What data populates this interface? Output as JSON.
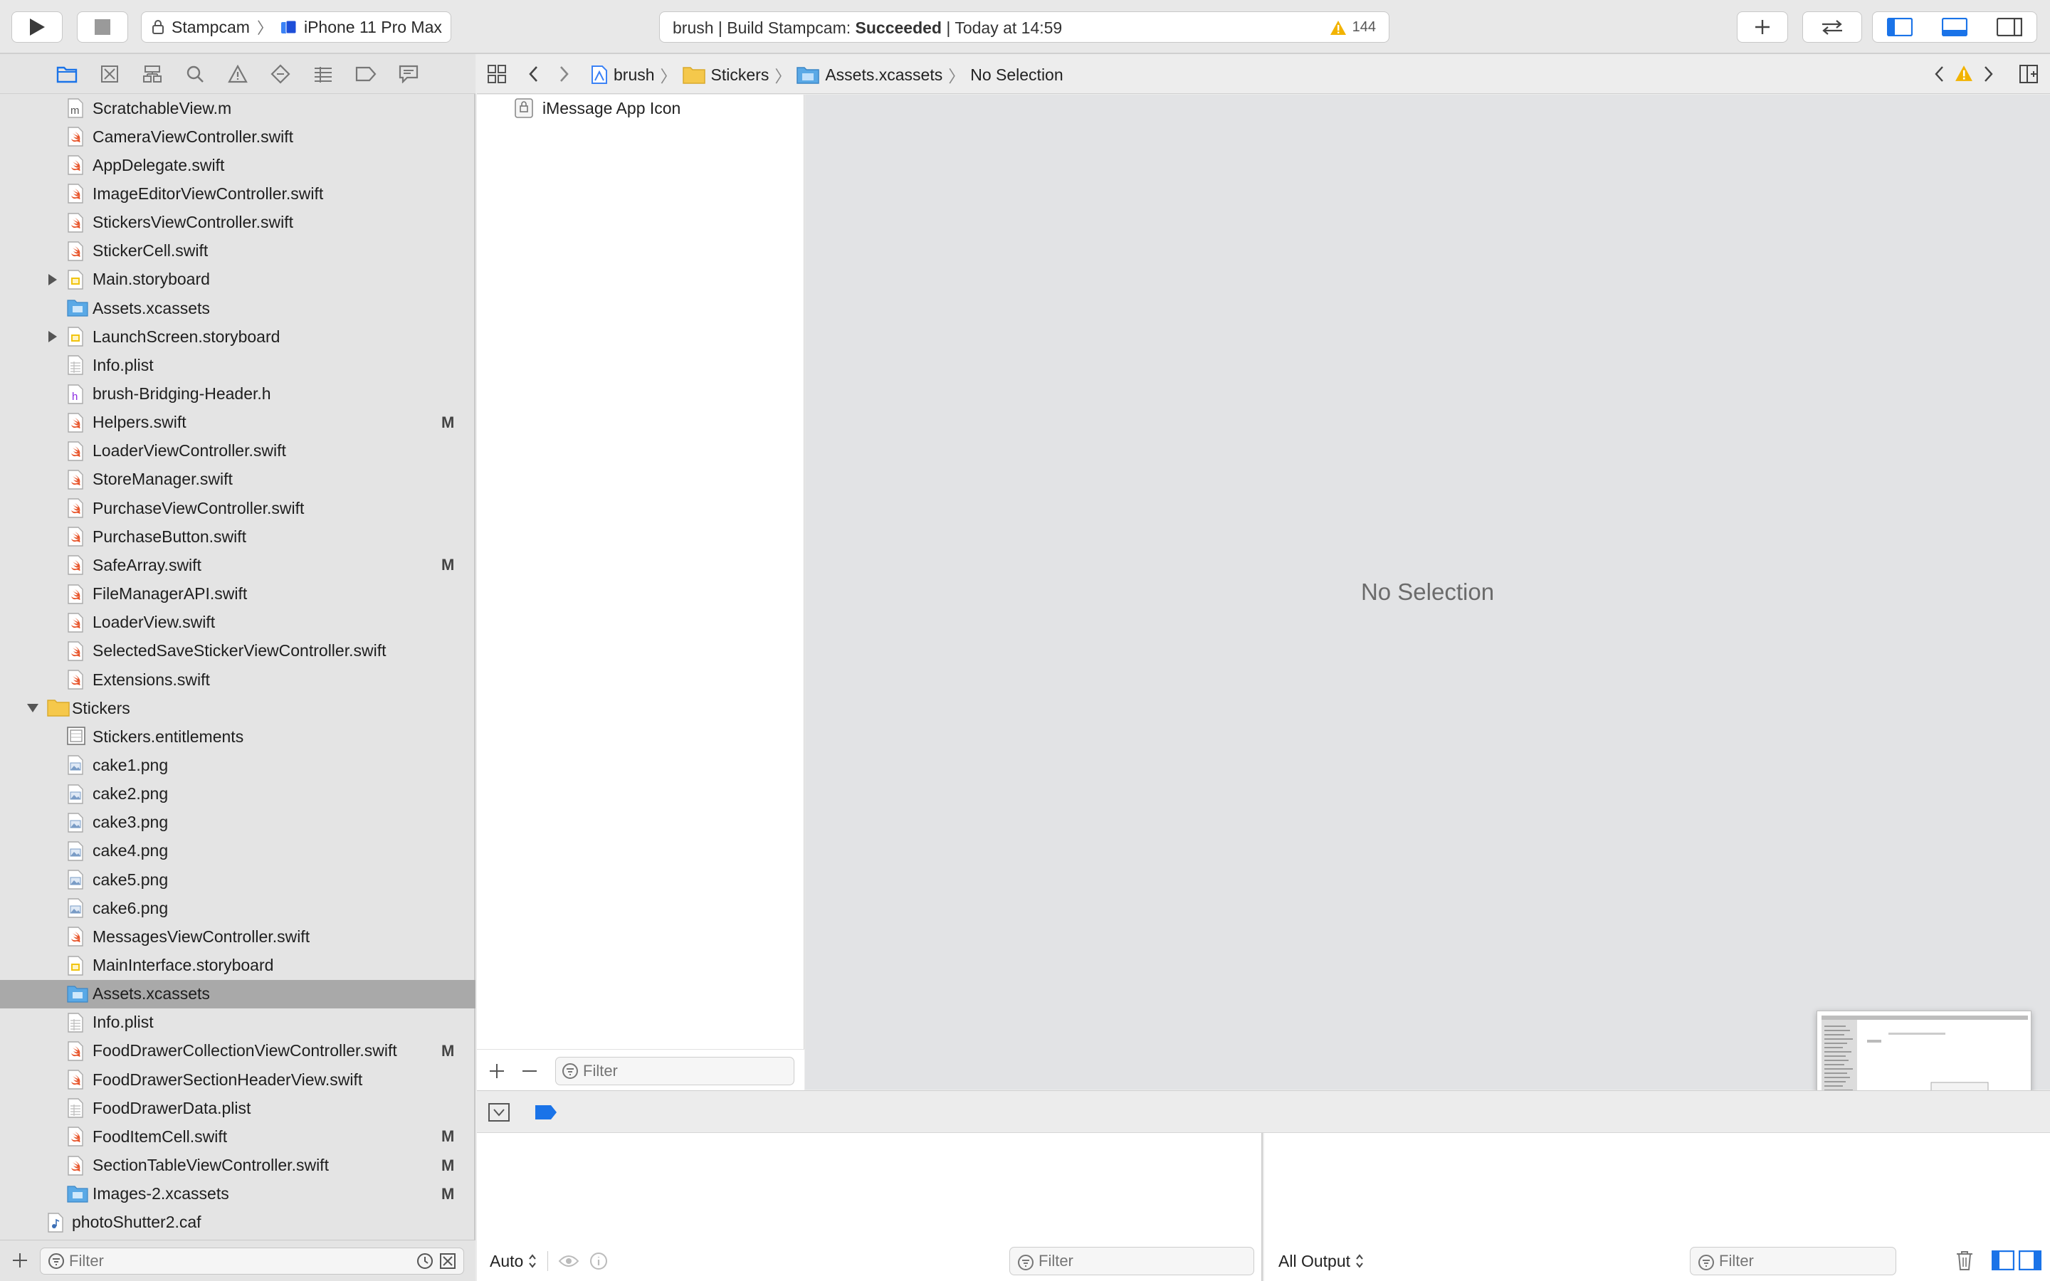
{
  "toolbar": {
    "scheme_target": "Stampcam",
    "scheme_device": "iPhone 11 Pro Max",
    "status_prefix": "brush | Build Stampcam: ",
    "status_result": "Succeeded",
    "status_suffix": " | Today at 14:59",
    "warning_count": "144"
  },
  "navigator": {
    "items": [
      {
        "label": "ScratchableView.m",
        "icon": "m"
      },
      {
        "label": "CameraViewController.swift",
        "icon": "swift"
      },
      {
        "label": "AppDelegate.swift",
        "icon": "swift"
      },
      {
        "label": "ImageEditorViewController.swift",
        "icon": "swift"
      },
      {
        "label": "StickersViewController.swift",
        "icon": "swift"
      },
      {
        "label": "StickerCell.swift",
        "icon": "swift"
      },
      {
        "label": "Main.storyboard",
        "icon": "storyboard"
      },
      {
        "label": "Assets.xcassets",
        "icon": "assets"
      },
      {
        "label": "LaunchScreen.storyboard",
        "icon": "storyboard"
      },
      {
        "label": "Info.plist",
        "icon": "plist"
      },
      {
        "label": "brush-Bridging-Header.h",
        "icon": "h"
      },
      {
        "label": "Helpers.swift",
        "icon": "swift",
        "badge": "M"
      },
      {
        "label": "LoaderViewController.swift",
        "icon": "swift"
      },
      {
        "label": "StoreManager.swift",
        "icon": "swift"
      },
      {
        "label": "PurchaseViewController.swift",
        "icon": "swift"
      },
      {
        "label": "PurchaseButton.swift",
        "icon": "swift"
      },
      {
        "label": "SafeArray.swift",
        "icon": "swift",
        "badge": "M"
      },
      {
        "label": "FileManagerAPI.swift",
        "icon": "swift"
      },
      {
        "label": "LoaderView.swift",
        "icon": "swift"
      },
      {
        "label": "SelectedSaveStickerViewController.swift",
        "icon": "swift"
      },
      {
        "label": "Extensions.swift",
        "icon": "swift"
      },
      {
        "label": "Stickers",
        "icon": "folder"
      },
      {
        "label": "Stickers.entitlements",
        "icon": "entitlements"
      },
      {
        "label": "cake1.png",
        "icon": "image"
      },
      {
        "label": "cake2.png",
        "icon": "image"
      },
      {
        "label": "cake3.png",
        "icon": "image"
      },
      {
        "label": "cake4.png",
        "icon": "image"
      },
      {
        "label": "cake5.png",
        "icon": "image"
      },
      {
        "label": "cake6.png",
        "icon": "image"
      },
      {
        "label": "MessagesViewController.swift",
        "icon": "swift"
      },
      {
        "label": "MainInterface.storyboard",
        "icon": "storyboard"
      },
      {
        "label": "Assets.xcassets",
        "icon": "assets"
      },
      {
        "label": "Info.plist",
        "icon": "plist"
      },
      {
        "label": "FoodDrawerCollectionViewController.swift",
        "icon": "swift",
        "badge": "M"
      },
      {
        "label": "FoodDrawerSectionHeaderView.swift",
        "icon": "swift"
      },
      {
        "label": "FoodDrawerData.plist",
        "icon": "plist"
      },
      {
        "label": "FoodItemCell.swift",
        "icon": "swift",
        "badge": "M"
      },
      {
        "label": "SectionTableViewController.swift",
        "icon": "swift",
        "badge": "M"
      },
      {
        "label": "Images-2.xcassets",
        "icon": "assets",
        "badge": "M"
      },
      {
        "label": "photoShutter2.caf",
        "icon": "audio"
      }
    ],
    "filter_placeholder": "Filter"
  },
  "jumpbar": {
    "crumbs": [
      "brush",
      "Stickers",
      "Assets.xcassets",
      "No Selection"
    ]
  },
  "assets": {
    "items": [
      "iMessage App Icon"
    ],
    "filter_placeholder": "Filter"
  },
  "editor": {
    "empty_text": "No Selection"
  },
  "debug": {
    "variables_mode": "Auto",
    "variables_filter_placeholder": "Filter",
    "console_mode": "All Output",
    "console_filter_placeholder": "Filter"
  },
  "colors": {
    "accent": "#1a73e8",
    "warning": "#f2b300",
    "swift": "#e8552b",
    "folder": "#f5c84b",
    "assets": "#5aa9e6",
    "selected_row": "#a9a9a9"
  }
}
